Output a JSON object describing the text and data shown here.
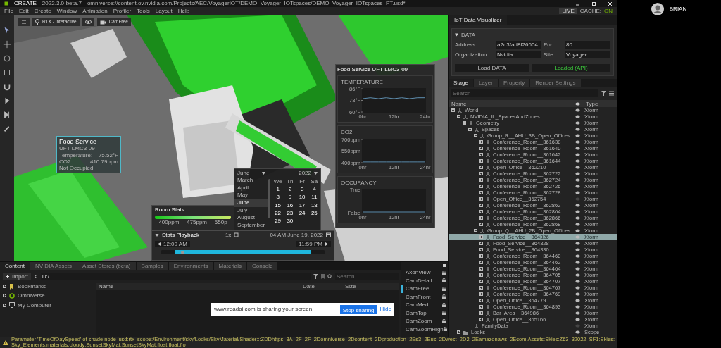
{
  "window": {
    "app": "CREATE",
    "version": "2022.3.0-beta.7",
    "path": "omniverse://content.ov.nvidia.com/Projects/AEC/VoyagerIOT/DEMO_Voyager_IOTspaces/DEMO_Voyager_IOTspaces_PT.usd*"
  },
  "menu": [
    "File",
    "Edit",
    "Create",
    "Window",
    "Animation",
    "Profiler",
    "Tools",
    "Layout",
    "Help"
  ],
  "live": {
    "label": "LIVE",
    "cache_label": "CACHE:",
    "cache_state": "ON"
  },
  "user": {
    "name": "BRIAN"
  },
  "viewport_toolbar": {
    "render_mode": "RTX - Interactive",
    "camera": "CamFree"
  },
  "room_tooltip": {
    "title": "Food Service",
    "subtitle": "UFT-LMC3-09",
    "rows": [
      {
        "label": "Temperature:",
        "value": "75.52°F"
      },
      {
        "label": "CO2:",
        "value": "410.79ppm"
      }
    ],
    "status": "Not Occupied"
  },
  "sensor_panel": {
    "title": "Food Service UFT-LMC3-09",
    "charts": [
      {
        "chart_data": {
          "type": "line",
          "title": "TEMPERATURE",
          "x": [
            0,
            3,
            6,
            9,
            12,
            15,
            18,
            21,
            24
          ],
          "xlim": [
            0,
            24
          ],
          "ylim": [
            60,
            86
          ],
          "xticks": [
            {
              "value": 0,
              "label": "0hr"
            },
            {
              "value": 12,
              "label": "12hr"
            },
            {
              "value": 24,
              "label": "24hr"
            }
          ],
          "yticks": [
            {
              "value": 86,
              "label": "86°F"
            },
            {
              "value": 73,
              "label": "73°F"
            },
            {
              "value": 60,
              "label": "60°F"
            }
          ],
          "series": [
            {
              "color": "#5f8fb0",
              "values": [
                75,
                76,
                75,
                76,
                75,
                76,
                75,
                76,
                76
              ]
            }
          ]
        }
      },
      {
        "chart_data": {
          "type": "line",
          "title": "CO2",
          "x": [
            0,
            3,
            6,
            9,
            12,
            15,
            18,
            21,
            24
          ],
          "xlim": [
            0,
            24
          ],
          "ylim": [
            400,
            700
          ],
          "xticks": [
            {
              "value": 0,
              "label": "0hr"
            },
            {
              "value": 12,
              "label": "12hr"
            },
            {
              "value": 24,
              "label": "24hr"
            }
          ],
          "yticks": [
            {
              "value": 700,
              "label": "700ppm"
            },
            {
              "value": 550,
              "label": "550ppm"
            },
            {
              "value": 400,
              "label": "400ppm"
            }
          ],
          "series": [
            {
              "color": "#5f8fb0",
              "values": [
                410,
                410,
                410,
                410,
                410,
                410,
                410,
                410,
                410
              ]
            }
          ]
        }
      },
      {
        "title": "OCCUPANCY",
        "y_labels": [
          "True",
          "False"
        ],
        "x_labels": [
          "0hr",
          "12hr",
          "24hr"
        ]
      }
    ]
  },
  "calendar": {
    "month": "June",
    "year": "2022",
    "months": [
      {
        "label": "March",
        "selected": false
      },
      {
        "label": "April",
        "selected": false
      },
      {
        "label": "May",
        "selected": false
      },
      {
        "label": "June",
        "selected": true
      },
      {
        "label": "July",
        "selected": false
      },
      {
        "label": "August",
        "selected": false
      },
      {
        "label": "September",
        "selected": false
      }
    ],
    "weekdays": [
      "We",
      "Th",
      "Fr",
      "Sa"
    ],
    "weeks": [
      [
        "1",
        "2",
        "3",
        "4"
      ],
      [
        "8",
        "9",
        "10",
        "11"
      ],
      [
        "15",
        "16",
        "17",
        "18"
      ],
      [
        "22",
        "23",
        "24",
        "25"
      ],
      [
        "29",
        "30"
      ]
    ]
  },
  "room_stats": {
    "title": "Room Stats",
    "scale": [
      "400ppm",
      "475ppm",
      "550p"
    ]
  },
  "playback": {
    "title": "Stats Playback",
    "expanded": true,
    "speed": "1x",
    "datetime": "04 AM June 19, 2022",
    "start": "12:00 AM",
    "end": "11:59 PM",
    "level": 0.06
  },
  "iot_panel": {
    "tab": "IoT Data Visualizer",
    "section": {
      "title": "DATA",
      "expanded": true
    },
    "fields": [
      {
        "label": "Address:",
        "value": "a2d3fad8f26604"
      },
      {
        "label": "Port:",
        "value": "80"
      },
      {
        "label": "Organization:",
        "value": "Nvidia"
      },
      {
        "label": "Site:",
        "value": "Voyager"
      }
    ],
    "buttons": [
      {
        "label": "Load DATA",
        "kind": "action"
      },
      {
        "label": "Loaded (API)",
        "kind": "status"
      }
    ]
  },
  "stage": {
    "tabs": [
      {
        "label": "Stage",
        "selected": true
      },
      {
        "label": "Layer",
        "selected": false
      },
      {
        "label": "Property",
        "selected": false
      },
      {
        "label": "Render Settings",
        "selected": false
      }
    ],
    "search": {
      "placeholder": "Search"
    },
    "columns": [
      "Name",
      "Type"
    ],
    "tree": [
      {
        "name": "World",
        "type": "Xform",
        "kind": "xform",
        "visible": true,
        "selected": false,
        "expanded": true,
        "children": [
          {
            "name": "NVIDIA_IL_SpacesAndZones",
            "type": "Xform",
            "kind": "xform",
            "visible": true,
            "selected": false,
            "expanded": true,
            "children": [
              {
                "name": "Geometry",
                "type": "Xform",
                "kind": "xform",
                "visible": true,
                "selected": false,
                "expanded": true,
                "children": [
                  {
                    "name": "Spaces",
                    "type": "Xform",
                    "kind": "xform",
                    "visible": true,
                    "selected": false,
                    "expanded": true,
                    "children": [
                      {
                        "name": "Group_R__AHU_3B_Open_Offices",
                        "type": "Xform",
                        "kind": "xform",
                        "visible": true,
                        "selected": false,
                        "expanded": true,
                        "children": [
                          {
                            "name": "Conference_Room__361638",
                            "type": "Xform",
                            "kind": "xform",
                            "visible": true,
                            "selected": false,
                            "expanded": false
                          },
                          {
                            "name": "Conference_Room__361640",
                            "type": "Xform",
                            "kind": "xform",
                            "visible": true,
                            "selected": false,
                            "expanded": false
                          },
                          {
                            "name": "Conference_Room__361642",
                            "type": "Xform",
                            "kind": "xform",
                            "visible": true,
                            "selected": false,
                            "expanded": false
                          },
                          {
                            "name": "Conference_Room__361644",
                            "type": "Xform",
                            "kind": "xform",
                            "visible": true,
                            "selected": false,
                            "expanded": false
                          },
                          {
                            "name": "Open_Office__362210",
                            "type": "Xform",
                            "kind": "xform",
                            "visible": true,
                            "selected": false,
                            "expanded": false
                          },
                          {
                            "name": "Conference_Room__362722",
                            "type": "Xform",
                            "kind": "xform",
                            "visible": true,
                            "selected": false,
                            "expanded": false
                          },
                          {
                            "name": "Conference_Room__362724",
                            "type": "Xform",
                            "kind": "xform",
                            "visible": true,
                            "selected": false,
                            "expanded": false
                          },
                          {
                            "name": "Conference_Room__362726",
                            "type": "Xform",
                            "kind": "xform",
                            "visible": true,
                            "selected": false,
                            "expanded": false
                          },
                          {
                            "name": "Conference_Room__362728",
                            "type": "Xform",
                            "kind": "xform",
                            "visible": true,
                            "selected": false,
                            "expanded": false
                          },
                          {
                            "name": "Open_Office__362754",
                            "type": "Xform",
                            "kind": "xform",
                            "visible": false,
                            "selected": false,
                            "expanded": false
                          },
                          {
                            "name": "Conference_Room__362862",
                            "type": "Xform",
                            "kind": "xform",
                            "visible": true,
                            "selected": false,
                            "expanded": false
                          },
                          {
                            "name": "Conference_Room__362864",
                            "type": "Xform",
                            "kind": "xform",
                            "visible": true,
                            "selected": false,
                            "expanded": false
                          },
                          {
                            "name": "Conference_Room__362866",
                            "type": "Xform",
                            "kind": "xform",
                            "visible": true,
                            "selected": false,
                            "expanded": false
                          },
                          {
                            "name": "Conference_Room__362868",
                            "type": "Xform",
                            "kind": "xform",
                            "visible": true,
                            "selected": false,
                            "expanded": false
                          }
                        ]
                      },
                      {
                        "name": "Group_Q__AHU_2B_Open_Offices",
                        "type": "Xform",
                        "kind": "xform",
                        "visible": true,
                        "selected": false,
                        "expanded": true,
                        "children": [
                          {
                            "name": "Food_Service__364326",
                            "type": "Xform",
                            "kind": "xform",
                            "visible": true,
                            "selected": true,
                            "expanded": false
                          },
                          {
                            "name": "Food_Service__364328",
                            "type": "Xform",
                            "kind": "xform",
                            "visible": true,
                            "selected": false,
                            "expanded": false
                          },
                          {
                            "name": "Food_Service__364330",
                            "type": "Xform",
                            "kind": "xform",
                            "visible": true,
                            "selected": false,
                            "expanded": false
                          },
                          {
                            "name": "Conference_Room__364460",
                            "type": "Xform",
                            "kind": "xform",
                            "visible": true,
                            "selected": false,
                            "expanded": false
                          },
                          {
                            "name": "Conference_Room__364462",
                            "type": "Xform",
                            "kind": "xform",
                            "visible": true,
                            "selected": false,
                            "expanded": false
                          },
                          {
                            "name": "Conference_Room__364464",
                            "type": "Xform",
                            "kind": "xform",
                            "visible": true,
                            "selected": false,
                            "expanded": false
                          },
                          {
                            "name": "Conference_Room__364705",
                            "type": "Xform",
                            "kind": "xform",
                            "visible": true,
                            "selected": false,
                            "expanded": false
                          },
                          {
                            "name": "Conference_Room__364707",
                            "type": "Xform",
                            "kind": "xform",
                            "visible": true,
                            "selected": false,
                            "expanded": false
                          },
                          {
                            "name": "Conference_Room__364767",
                            "type": "Xform",
                            "kind": "xform",
                            "visible": true,
                            "selected": false,
                            "expanded": false
                          },
                          {
                            "name": "Conference_Room__364769",
                            "type": "Xform",
                            "kind": "xform",
                            "visible": true,
                            "selected": false,
                            "expanded": false
                          },
                          {
                            "name": "Open_Office__364779",
                            "type": "Xform",
                            "kind": "xform",
                            "visible": true,
                            "selected": false,
                            "expanded": false
                          },
                          {
                            "name": "Conference_Room__364893",
                            "type": "Xform",
                            "kind": "xform",
                            "visible": true,
                            "selected": false,
                            "expanded": false
                          },
                          {
                            "name": "Bar_Area__364986",
                            "type": "Xform",
                            "kind": "xform",
                            "visible": true,
                            "selected": false,
                            "expanded": false
                          },
                          {
                            "name": "Open_Office__365166",
                            "type": "Xform",
                            "kind": "xform",
                            "visible": true,
                            "selected": false,
                            "expanded": false
                          }
                        ]
                      }
                    ]
                  },
                  {
                    "name": "FamilyData",
                    "type": "Xform",
                    "kind": "xform",
                    "visible": false,
                    "selected": false
                  }
                ]
              }
            ]
          },
          {
            "name": "Looks",
            "type": "Scope",
            "kind": "scope",
            "visible": true,
            "selected": false,
            "expanded": false
          }
        ]
      }
    ]
  },
  "content": {
    "tabs": [
      {
        "label": "Content",
        "selected": true
      },
      {
        "label": "NVIDIA Assets",
        "selected": false
      },
      {
        "label": "Asset Stores (beta)",
        "selected": false
      },
      {
        "label": "Samples",
        "selected": false
      },
      {
        "label": "Environments",
        "selected": false
      },
      {
        "label": "Materials",
        "selected": false
      },
      {
        "label": "Console",
        "selected": false
      }
    ],
    "import": "Import",
    "path": "D:/",
    "search": {
      "placeholder": "Search"
    },
    "locations": [
      {
        "label": "Bookmarks",
        "kind": "bookmark",
        "expanded": false
      },
      {
        "label": "Omniverse",
        "kind": "omniverse",
        "expanded": false
      },
      {
        "label": "My Computer",
        "kind": "computer",
        "expanded": false
      }
    ],
    "columns": [
      "Name",
      "Date",
      "Size"
    ]
  },
  "share_bar": {
    "message": "www.readai.com is sharing your screen.",
    "stop": "Stop sharing",
    "hide": "Hide"
  },
  "cameras": [
    {
      "name": "AxonView",
      "selected": false
    },
    {
      "name": "CamDetail",
      "selected": false
    },
    {
      "name": "CamFree",
      "selected": true
    },
    {
      "name": "CamFront",
      "selected": false
    },
    {
      "name": "CamMed",
      "selected": false
    },
    {
      "name": "CamTop",
      "selected": false
    },
    {
      "name": "CamZoom",
      "selected": false
    },
    {
      "name": "CamZoomHigh",
      "selected": false
    }
  ],
  "status_bar": {
    "kind": "warning",
    "message": "Parameter 'TimeOfDaySpeed' of shade node 'usd:rtx_scope:/Environment/sky/Looks/SkyMaterial/Shader:::ZDDhttps_3A_2F_2F_2Domniverse_2Dcontent_2Dproduction_2Es3_2Eus_2Dwest_2D2_2Eamazonaws_2Ecom:Assets:Skies:Z63_32022_SF1:Skies:Sky_Elements:materials:cloudy:SunsetSkyMat:SunsetSkyMat:float,float,flo"
  }
}
